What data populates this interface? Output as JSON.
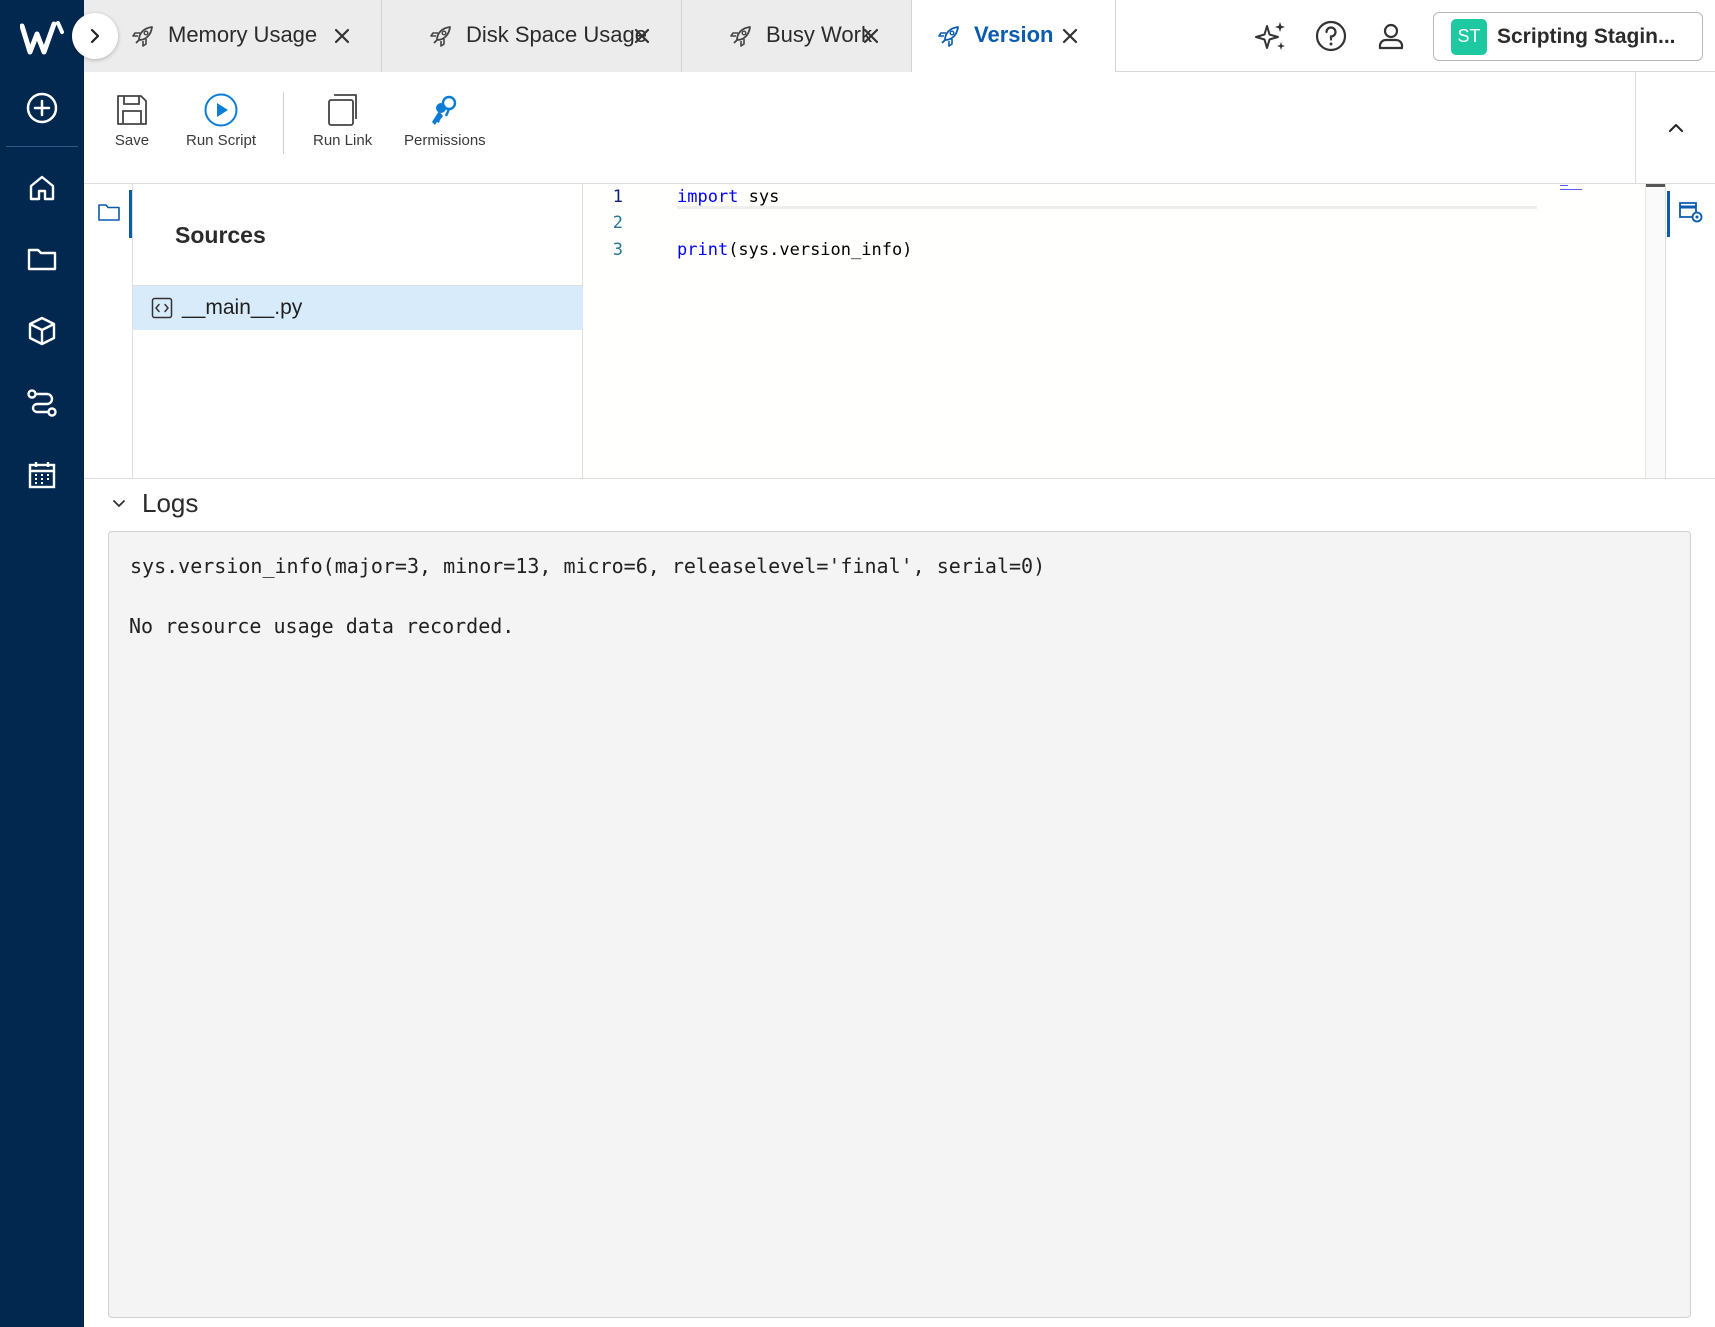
{
  "nav": {
    "logo": "W",
    "items": [
      {
        "icon": "plus-circle-icon"
      },
      {
        "icon": "home-icon"
      },
      {
        "icon": "folder-icon"
      },
      {
        "icon": "cube-icon"
      },
      {
        "icon": "workflow-icon"
      },
      {
        "icon": "calendar-icon"
      }
    ]
  },
  "tabs": [
    {
      "label": "Memory Usage",
      "active": false
    },
    {
      "label": "Disk Space Usage",
      "active": false
    },
    {
      "label": "Busy Work",
      "active": false
    },
    {
      "label": "Version",
      "active": true
    }
  ],
  "header": {
    "account_initials": "ST",
    "account_name": "Scripting Stagin...",
    "account_color": "#1ec8a0"
  },
  "toolbar": {
    "save_label": "Save",
    "run_script_label": "Run Script",
    "run_link_label": "Run Link",
    "permissions_label": "Permissions"
  },
  "sources": {
    "title": "Sources",
    "files": [
      {
        "name": "__main__.py",
        "selected": true
      }
    ]
  },
  "editor": {
    "line_numbers": [
      "1",
      "2",
      "3"
    ],
    "lines": [
      {
        "keyword": "import",
        "rest": " sys"
      },
      {
        "keyword": "",
        "rest": ""
      },
      {
        "keyword": "print",
        "rest": "(sys.version_info)"
      }
    ]
  },
  "logs": {
    "title": "Logs",
    "lines": [
      "sys.version_info(major=3, minor=13, micro=6, releaselevel='final', serial=0)",
      "No resource usage data recorded."
    ]
  },
  "colors": {
    "nav_bg": "#02284f",
    "accent": "#0b5cad",
    "selected_row": "#d8ebfa"
  }
}
